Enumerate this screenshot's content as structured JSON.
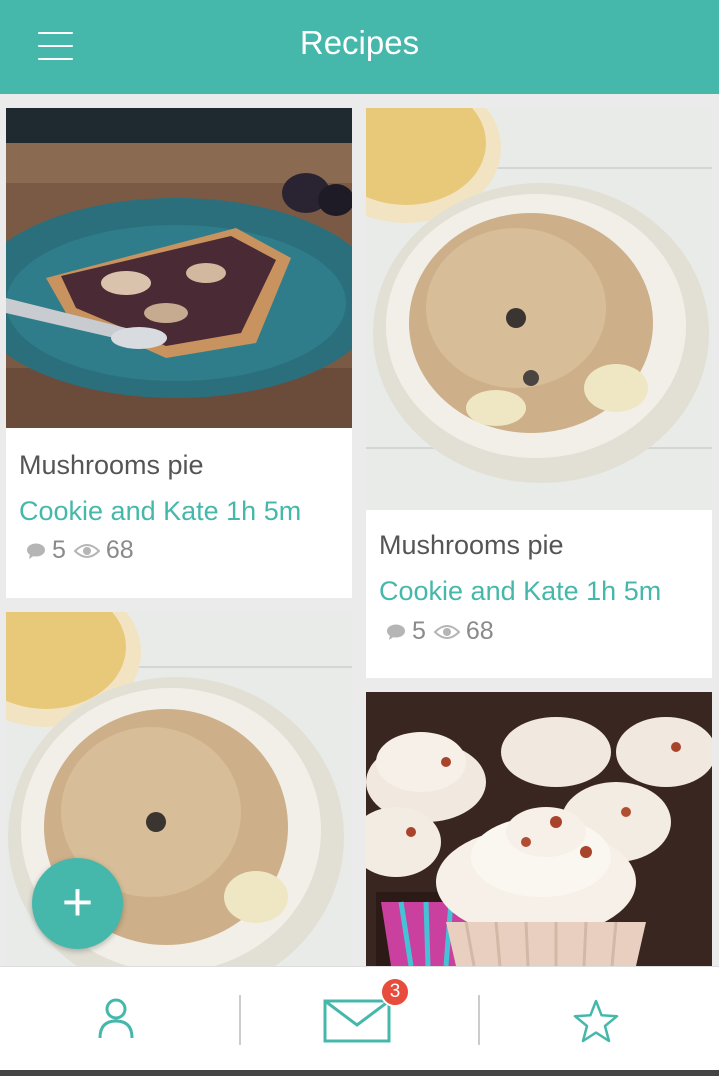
{
  "header": {
    "title": "Recipes"
  },
  "cards": [
    {
      "title": "Mushrooms pie",
      "source": "Cookie and Kate",
      "duration": "1h 5m",
      "comments": "5",
      "views": "68"
    },
    {
      "title": "Mushrooms pie",
      "source": "Cookie and Kate",
      "duration": "1h 5m",
      "comments": "5",
      "views": "68"
    }
  ],
  "fab": {
    "label": "+"
  },
  "bottom_nav": {
    "messages_badge": "3"
  },
  "colors": {
    "accent": "#45b8ab",
    "badge": "#e74c3c",
    "text": "#555555",
    "muted": "#8a8a8a"
  },
  "icons": [
    "menu-icon",
    "comment-icon",
    "eye-icon",
    "plus-icon",
    "user-icon",
    "mail-icon",
    "star-icon"
  ]
}
